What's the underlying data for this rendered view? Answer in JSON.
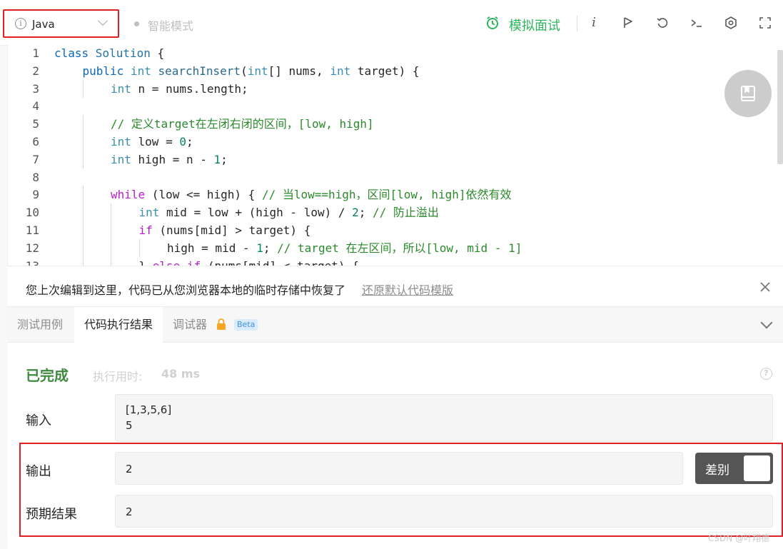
{
  "toolbar": {
    "language": "Java",
    "mode_label": "智能模式",
    "mock_interview_label": "模拟面试",
    "info_glyph": "i"
  },
  "editor": {
    "lines": [
      {
        "n": "1",
        "indent": 0,
        "segs": [
          [
            "kw",
            "class"
          ],
          [
            "",
            ""
          ],
          [
            "cls",
            " Solution"
          ],
          [
            "",
            " {"
          ]
        ]
      },
      {
        "n": "2",
        "indent": 1,
        "segs": [
          [
            "kw",
            "public"
          ],
          [
            "type",
            " int"
          ],
          [
            "fn",
            " searchInsert"
          ],
          [
            "",
            "("
          ],
          [
            "type",
            "int"
          ],
          [
            "",
            "[] nums, "
          ],
          [
            "type",
            "int"
          ],
          [
            "",
            " target) {"
          ]
        ]
      },
      {
        "n": "3",
        "indent": 2,
        "segs": [
          [
            "type",
            "int"
          ],
          [
            "",
            " n = nums.length;"
          ]
        ]
      },
      {
        "n": "4",
        "indent": 0,
        "segs": []
      },
      {
        "n": "5",
        "indent": 2,
        "segs": [
          [
            "cm",
            "// 定义target在左闭右闭的区间，[low, high]"
          ]
        ]
      },
      {
        "n": "6",
        "indent": 2,
        "segs": [
          [
            "type",
            "int"
          ],
          [
            "",
            " low = "
          ],
          [
            "num",
            "0"
          ],
          [
            "",
            ";"
          ]
        ]
      },
      {
        "n": "7",
        "indent": 2,
        "segs": [
          [
            "type",
            "int"
          ],
          [
            "",
            " high = n - "
          ],
          [
            "num",
            "1"
          ],
          [
            "",
            ";"
          ]
        ]
      },
      {
        "n": "8",
        "indent": 0,
        "segs": []
      },
      {
        "n": "9",
        "indent": 2,
        "segs": [
          [
            "ctl",
            "while"
          ],
          [
            "",
            " (low <= high) { "
          ],
          [
            "cm",
            "// 当low==high，区间[low, high]依然有效"
          ]
        ]
      },
      {
        "n": "10",
        "indent": 3,
        "segs": [
          [
            "type",
            "int"
          ],
          [
            "",
            " mid = low + (high - low) / "
          ],
          [
            "num",
            "2"
          ],
          [
            "",
            "; "
          ],
          [
            "cm",
            "// 防止溢出"
          ]
        ]
      },
      {
        "n": "11",
        "indent": 3,
        "segs": [
          [
            "ctl",
            "if"
          ],
          [
            "",
            " (nums[mid] > target) {"
          ]
        ]
      },
      {
        "n": "12",
        "indent": 4,
        "segs": [
          [
            "",
            "high = mid - "
          ],
          [
            "num",
            "1"
          ],
          [
            "",
            "; "
          ],
          [
            "cm",
            "// target 在左区间，所以[low, mid - 1]"
          ]
        ]
      },
      {
        "n": "13",
        "indent": 3,
        "segs": [
          [
            "",
            "} "
          ],
          [
            "ctl",
            "else if"
          ],
          [
            "",
            " (nums[mid] < target) {"
          ]
        ]
      }
    ]
  },
  "notice": {
    "message": "您上次编辑到这里，代码已从您浏览器本地的临时存储中恢复了",
    "restore_link": "还原默认代码模版"
  },
  "tabs": [
    {
      "label": "测试用例"
    },
    {
      "label": "代码执行结果"
    },
    {
      "label": "调试器"
    }
  ],
  "beta_label": "Beta",
  "result": {
    "status": "已完成",
    "runtime_label": "执行用时:",
    "runtime_value": "48 ms",
    "input_label": "输入",
    "input_lines": [
      "[1,3,5,6]",
      "5"
    ],
    "output_label": "输出",
    "output_value": "2",
    "expected_label": "预期结果",
    "expected_value": "2",
    "diff_label": "差别",
    "help_glyph": "?"
  },
  "watermark": "CSDN @叶翔德",
  "colors": {
    "accent_green": "#2db55d",
    "status_green": "#3f8a3f",
    "highlight_red": "#e02020"
  }
}
